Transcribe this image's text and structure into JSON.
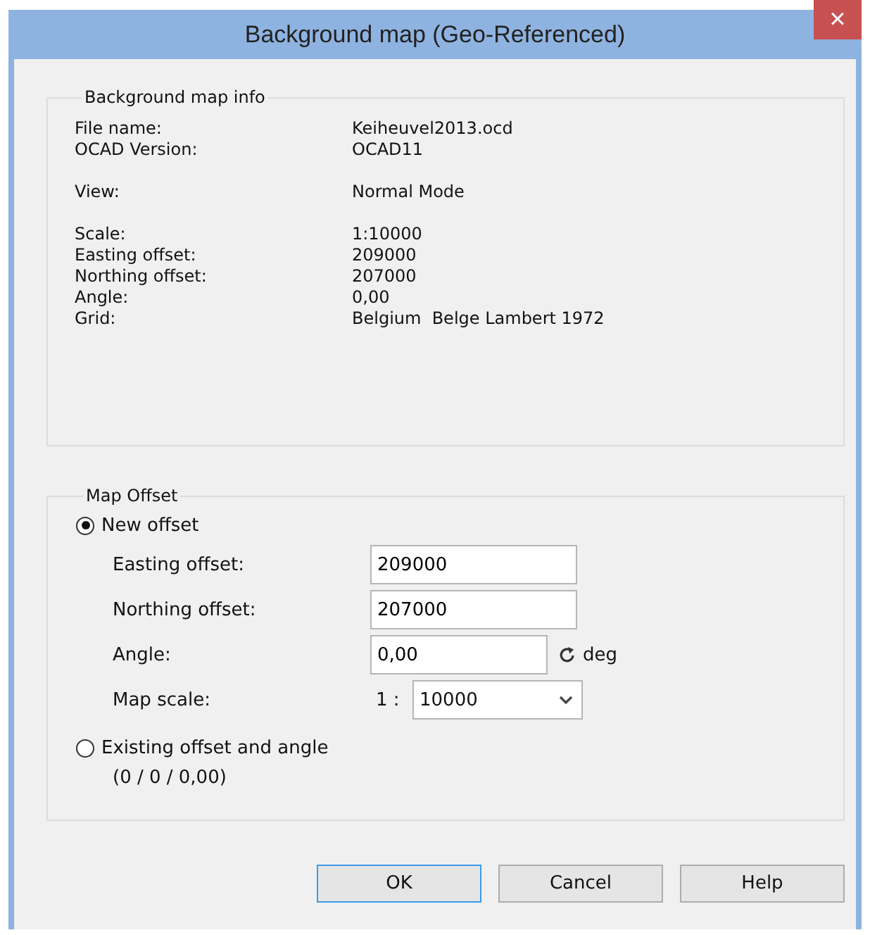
{
  "window": {
    "title": "Background map (Geo-Referenced)",
    "close": "×"
  },
  "info": {
    "title": "Background map info",
    "groups": [
      [
        {
          "label": "File name:",
          "value": "Keiheuvel2013.ocd"
        },
        {
          "label": "OCAD Version:",
          "value": "OCAD11"
        }
      ],
      [
        {
          "label": "View:",
          "value": "Normal Mode"
        }
      ],
      [
        {
          "label": "Scale:",
          "value": "1:10000"
        },
        {
          "label": "Easting offset:",
          "value": "209000"
        },
        {
          "label": "Northing offset:",
          "value": "207000"
        },
        {
          "label": "Angle:",
          "value": "0,00"
        },
        {
          "label": "Grid:",
          "value": "Belgium  Belge Lambert 1972"
        }
      ]
    ]
  },
  "offset": {
    "title": "Map Offset",
    "new_option": {
      "label": "New offset",
      "selected": true
    },
    "fields": [
      {
        "kind": "text",
        "label": "Easting offset:",
        "value": "209000"
      },
      {
        "kind": "text",
        "label": "Northing offset:",
        "value": "207000"
      },
      {
        "kind": "angle",
        "label": "Angle:",
        "value": "0,00",
        "unit": "deg"
      },
      {
        "kind": "select",
        "label": "Map scale:",
        "prefix": "1 :",
        "value": "10000"
      }
    ],
    "existing_option": {
      "label": "Existing offset and angle",
      "selected": false,
      "note": "(0 / 0 / 0,00)"
    }
  },
  "buttons": [
    {
      "label": "OK",
      "default": true
    },
    {
      "label": "Cancel",
      "default": false
    },
    {
      "label": "Help",
      "default": false
    }
  ]
}
